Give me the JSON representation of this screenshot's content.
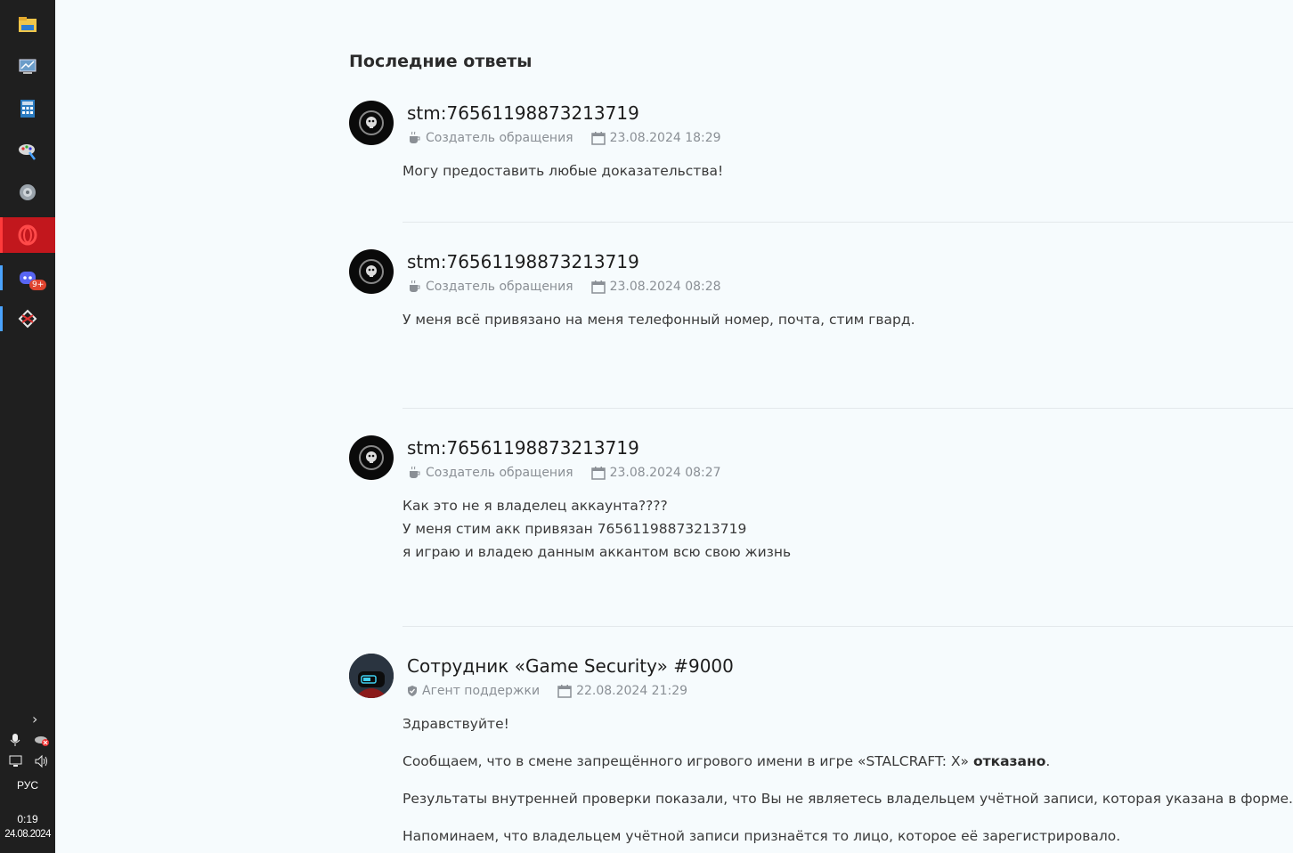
{
  "taskbar": {
    "apps": [
      {
        "name": "file-explorer"
      },
      {
        "name": "control-panel"
      },
      {
        "name": "calculator"
      },
      {
        "name": "paint"
      },
      {
        "name": "speakers"
      },
      {
        "name": "opera"
      },
      {
        "name": "discord",
        "badge": "9+"
      },
      {
        "name": "stalcraft"
      }
    ],
    "lang": "РУС",
    "time": "0:19",
    "date": "24.08.2024"
  },
  "section_title": "Последние ответы",
  "replies": [
    {
      "author": "stm:76561198873213719",
      "role": "Создатель обращения",
      "datetime": "23.08.2024 18:29",
      "lines": [
        "Могу предоставить любые доказательства!"
      ]
    },
    {
      "author": "stm:76561198873213719",
      "role": "Создатель обращения",
      "datetime": "23.08.2024 08:28",
      "lines": [
        "У меня всё привязано на меня телефонный номер, почта, стим гвард."
      ]
    },
    {
      "author": "stm:76561198873213719",
      "role": "Создатель обращения",
      "datetime": "23.08.2024 08:27",
      "lines": [
        "Как это не я владелец аккаунта????",
        "У меня стим акк привязан 76561198873213719",
        "я играю и владею данным аккантом всю свою жизнь"
      ]
    },
    {
      "author": "Сотрудник «Game Security» #9000",
      "role": "Агент поддержки",
      "datetime": "22.08.2024 21:29",
      "greeting": "Здравствуйте!",
      "p1_before": "Сообщаем, что в смене запрещённого игрового имени в игре «STALCRAFT: X» ",
      "p1_bold": "отказано",
      "p1_after": ".",
      "p2": "Результаты внутренней проверки показали, что Вы не являетесь владельцем учётной записи, которая указана в форме.",
      "p3": "Напоминаем, что владельцем учётной записи признаётся то лицо, которое её зарегистрировало."
    }
  ],
  "colors": {
    "background": "#f6fbfd",
    "taskbar": "#1f1f1f",
    "active_app": "#c2171d",
    "meta_text": "#8a8f95"
  }
}
